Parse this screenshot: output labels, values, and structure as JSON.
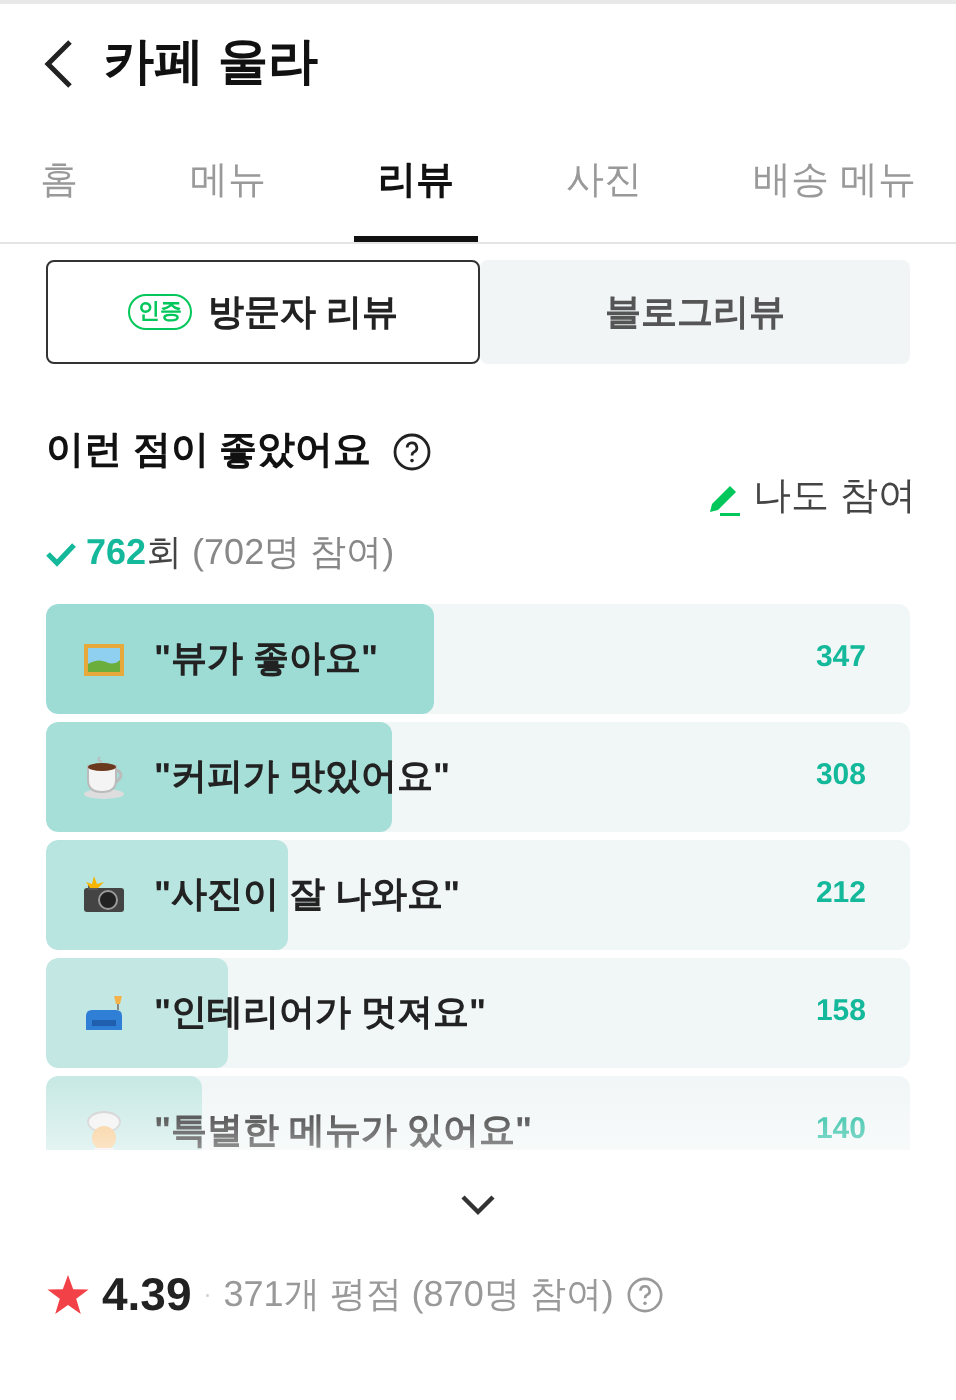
{
  "header": {
    "title": "카페 울라"
  },
  "tabs": [
    {
      "label": "홈",
      "selected": false
    },
    {
      "label": "메뉴",
      "selected": false
    },
    {
      "label": "리뷰",
      "selected": true
    },
    {
      "label": "사진",
      "selected": false
    },
    {
      "label": "배송 메뉴",
      "selected": false
    }
  ],
  "review_types": [
    {
      "label": "방문자 리뷰",
      "badge": "인증",
      "selected": true
    },
    {
      "label": "블로그리뷰",
      "selected": false
    }
  ],
  "section": {
    "title": "이런 점이 좋았어요",
    "participate": "나도 참여",
    "count": "762",
    "count_unit": "회",
    "participants": "(702명 참여)"
  },
  "keywords": [
    {
      "label": "\"뷰가 좋아요\"",
      "count": "347",
      "level": 0.45
    },
    {
      "label": "\"커피가 맛있어요\"",
      "count": "308",
      "level": 0.4
    },
    {
      "label": "\"사진이 잘 나와요\"",
      "count": "212",
      "level": 0.28
    },
    {
      "label": "\"인테리어가 멋져요\"",
      "count": "158",
      "level": 0.21
    },
    {
      "label": "\"특별한 메뉴가 있어요\"",
      "count": "140",
      "level": 0.18
    }
  ],
  "rating": {
    "score": "4.39",
    "separator": "·",
    "summary": "371개 평점 (870명 참여)"
  }
}
